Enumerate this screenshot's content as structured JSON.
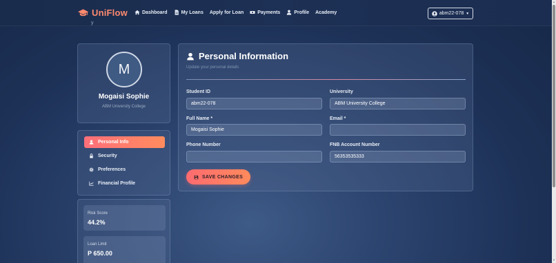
{
  "brand": {
    "name": "UniFlow",
    "icon": "graduation-cap-icon",
    "color": "#ff8a6e"
  },
  "nav": {
    "items": [
      {
        "label": "Dashboard",
        "icon": "home-icon"
      },
      {
        "label": "My Loans",
        "icon": "file-icon"
      },
      {
        "label": "Apply for Loan",
        "icon": ""
      },
      {
        "label": "Payments",
        "icon": "money-icon"
      },
      {
        "label": "Profile",
        "icon": "user-icon"
      },
      {
        "label": "Academy",
        "icon": ""
      }
    ],
    "user_label": "abm22-078"
  },
  "breadcrumb": "y",
  "profile": {
    "avatar_letter": "M",
    "name": "Mogaisi Sophie",
    "university": "ABM University College"
  },
  "menu": {
    "items": [
      {
        "label": "Personal Info",
        "icon": "user-icon",
        "active": true
      },
      {
        "label": "Security",
        "icon": "lock-icon",
        "active": false
      },
      {
        "label": "Preferences",
        "icon": "gear-icon",
        "active": false
      },
      {
        "label": "Financial Profile",
        "icon": "chart-icon",
        "active": false
      }
    ]
  },
  "stats": {
    "risk_label": "Risk Score",
    "risk_value": "44.2%",
    "limit_label": "Loan Limit",
    "limit_value": "P 650.00"
  },
  "form": {
    "title": "Personal Information",
    "subtitle": "Update your personal details",
    "fields": {
      "student_id": {
        "label": "Student ID",
        "value": "abm22-078"
      },
      "university": {
        "label": "University",
        "value": "ABM University College"
      },
      "full_name": {
        "label": "Full Name *",
        "value": "Mogaisi Sophie"
      },
      "email": {
        "label": "Email *",
        "value": ""
      },
      "phone": {
        "label": "Phone Number",
        "value": ""
      },
      "fnb": {
        "label": "FNB Account Number",
        "value": "56353535333"
      }
    },
    "save_label": "SAVE CHANGES"
  },
  "colors": {
    "accent_start": "#ff6b70",
    "accent_end": "#ff8a5c",
    "background": "#1d3157"
  }
}
